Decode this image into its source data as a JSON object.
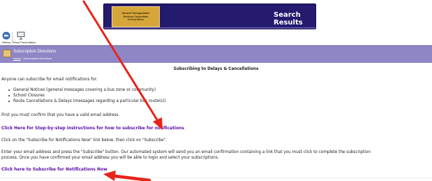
{
  "banner": {
    "logo_lines": [
      "Student Transportation",
      "Services Consortium",
      "of Grey Bruce"
    ],
    "title": "Search Results"
  },
  "toolbar": {
    "history_label": "History",
    "presentation_label": "Show Presentation"
  },
  "section": {
    "title": "Subscription Directions",
    "breadcrumb_home": "Home",
    "breadcrumb_sep": " › ",
    "breadcrumb_current": "Subscription Directions"
  },
  "content": {
    "heading": "Subscribing to Delays & Cancellations",
    "intro": "Anyone can subscribe for email notifications for:",
    "bullets": [
      "General Notices (general messages covering a bus zone or community)",
      "School Closures",
      "Route Cancellations & Delays (messages regarding a particular bus route(s))"
    ],
    "confirm_text": "First you must confirm that you have a valid email address.",
    "instructions_link": "Click Here for Step-by-step instructions for how to subscribe for notifications",
    "click_text": "Click on the \"Subscribe for Notifications Now\" link below, then click on \"Subscribe\".",
    "enter_text_1": "Enter your email address and press the \"Subscribe\" button.  Our automated system will send you an email confirmation containing a link that you must click to complete the subscription",
    "enter_text_2": "process.  Once you have confirmed your email address you will be able to login and select your subscriptions.",
    "subscribe_link": "Click here to Subscribe for Notifications Now"
  },
  "colors": {
    "banner_bg": "#241a6e",
    "section_bar": "#8f87c5",
    "link": "#5a0aa8",
    "annotation_arrow": "#e8231a"
  }
}
